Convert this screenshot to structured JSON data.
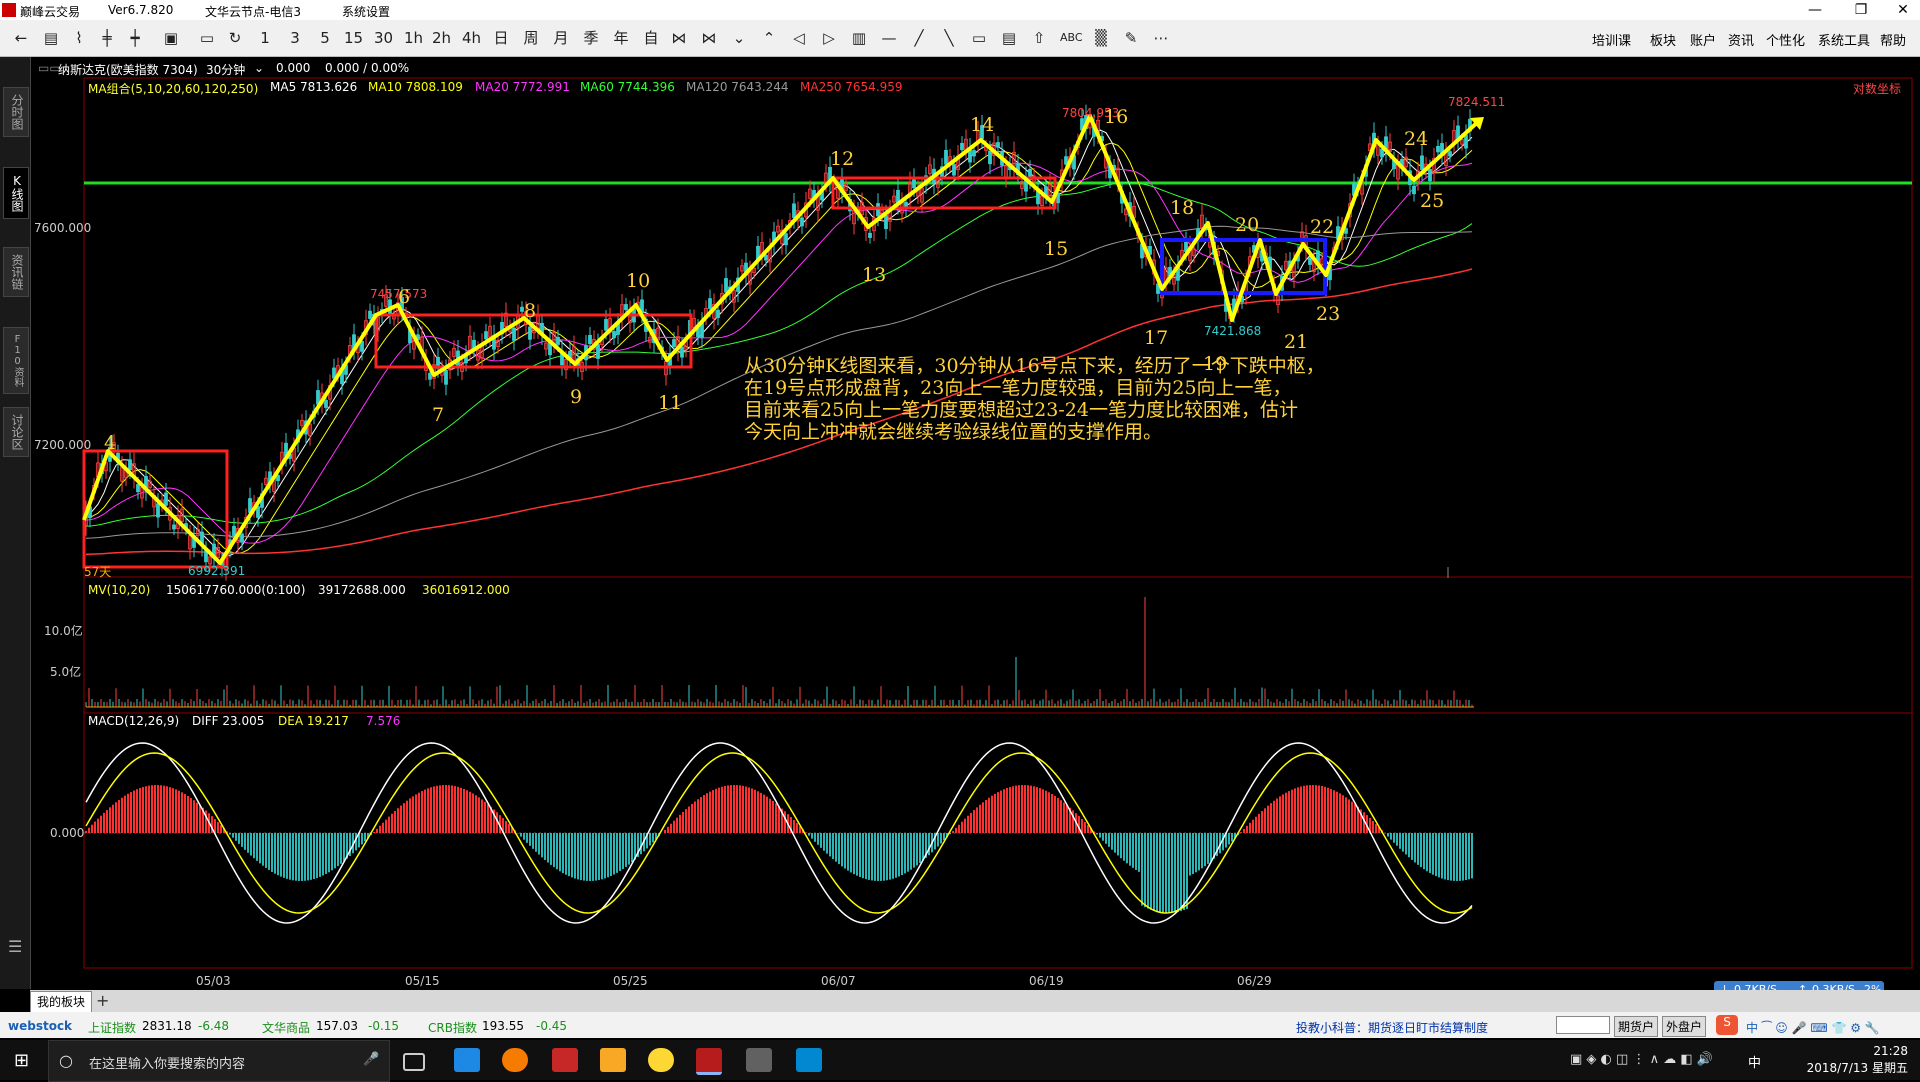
{
  "window": {
    "title": "巅峰云交易",
    "version": "Ver6.7.820",
    "server": "文华云节点-电信3",
    "menu_system": "系统设置"
  },
  "toolbar": {
    "periods": [
      "1",
      "3",
      "5",
      "15",
      "30",
      "1h",
      "2h",
      "4h",
      "日",
      "周",
      "月",
      "季",
      "年",
      "自"
    ],
    "right_menu": [
      "培训课",
      "板块",
      "账户",
      "资讯",
      "个性化",
      "系统工具",
      "帮助"
    ]
  },
  "side_tabs": [
    "分时图",
    "K线图",
    "资讯链",
    "F10资料",
    "讨论区"
  ],
  "instrument": {
    "name": "纳斯达克(欧美指数 7304)",
    "period": "30分钟",
    "last": "0.000",
    "change": "0.000 / 0.00%"
  },
  "ma_legend": {
    "group": "MA组合(5,10,20,60,120,250)",
    "items": [
      {
        "label": "MA5 7813.626",
        "color": "#ffffff"
      },
      {
        "label": "MA10 7808.109",
        "color": "#ffff00"
      },
      {
        "label": "MA20 7772.991",
        "color": "#ff33ff"
      },
      {
        "label": "MA60 7744.396",
        "color": "#33ff33"
      },
      {
        "label": "MA120 7643.244",
        "color": "#999999"
      },
      {
        "label": "MA250 7654.959",
        "color": "#ff3333"
      }
    ],
    "log_scale_label": "对数坐标"
  },
  "price_axis": [
    "7600.000",
    "7200.000"
  ],
  "price_marks": {
    "high_left": "7457.573",
    "low_left": "6992.391",
    "high_peak": "7804.953",
    "low_mid": "7421.868",
    "high_right": "7824.511",
    "days": "57天"
  },
  "wave_labels": [
    "4",
    "6",
    "7",
    "8",
    "9",
    "10",
    "11",
    "12",
    "13",
    "14",
    "15",
    "16",
    "17",
    "18",
    "19",
    "20",
    "21",
    "22",
    "23",
    "24",
    "25"
  ],
  "volume": {
    "legend": "MV(10,20)",
    "v1": "150617760.000(0:100)",
    "v2": "39172688.000",
    "v3": "36016912.000",
    "axis": [
      "10.0亿",
      "5.0亿"
    ]
  },
  "macd": {
    "legend": "MACD(12,26,9)",
    "diff": "DIFF 23.005",
    "dea": "DEA 19.217",
    "macd": "7.576",
    "axis_zero": "0.000"
  },
  "dates": [
    "05/03",
    "05/15",
    "05/25",
    "06/07",
    "06/19",
    "06/29"
  ],
  "annotation": [
    "从30分钟K线图来看，30分钟从16号点下来，经历了一个下跌中枢，",
    "在19号点形成盘背，23向上一笔力度较强，目前为25向上一笔，",
    "目前来看25向上一笔力度要想超过23-24一笔力度比较困难，估计",
    "今天向上冲冲就会继续考验绿线位置的支撑作用。"
  ],
  "bottom_tab": "我的板块",
  "status": {
    "brand": "webstock",
    "idx1_name": "上证指数",
    "idx1_val": "2831.18",
    "idx1_chg": "-6.48",
    "idx2_name": "文华商品",
    "idx2_val": "157.03",
    "idx2_chg": "-0.15",
    "idx3_name": "CRB指数",
    "idx3_val": "193.55",
    "idx3_chg": "-0.45",
    "tip": "投教小科普：期货逐日盯市结算制度",
    "btn_futures": "期货户",
    "btn_forex": "外盘户"
  },
  "network": {
    "down": "0.7KB/S",
    "up": "0.3KB/S",
    "pct": "2%"
  },
  "taskbar": {
    "search_placeholder": "在这里输入你要搜索的内容",
    "time": "21:28",
    "date": "2018/7/13 星期五",
    "ime": "中"
  }
}
